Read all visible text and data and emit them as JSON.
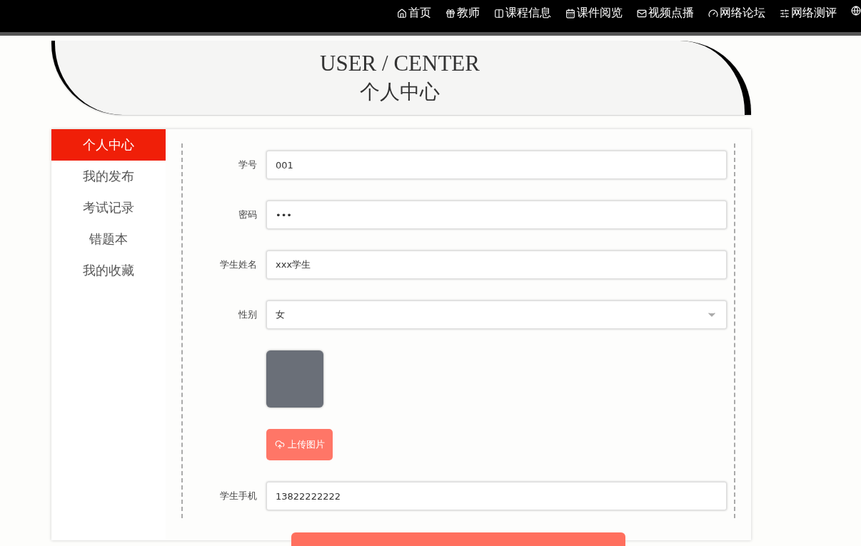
{
  "nav": {
    "items": [
      {
        "label": "首页"
      },
      {
        "label": "教师"
      },
      {
        "label": "课程信息"
      },
      {
        "label": "课件阅览"
      },
      {
        "label": "视频点播"
      },
      {
        "label": "网络论坛"
      },
      {
        "label": "网络测评"
      }
    ]
  },
  "header": {
    "title": "USER / CENTER",
    "subtitle": "个人中心"
  },
  "sidebar": {
    "items": [
      {
        "label": "个人中心",
        "selected": true
      },
      {
        "label": "我的发布",
        "selected": false
      },
      {
        "label": "考试记录",
        "selected": false
      },
      {
        "label": "错题本",
        "selected": false
      },
      {
        "label": "我的收藏",
        "selected": false
      }
    ]
  },
  "form": {
    "fields": [
      {
        "kind": "text",
        "label": "学号",
        "value": "001"
      },
      {
        "kind": "text",
        "label": "密码",
        "value": "•••"
      },
      {
        "kind": "text",
        "label": "学生姓名",
        "value": "xxx学生"
      },
      {
        "kind": "select",
        "label": "性别",
        "value": "女"
      },
      {
        "kind": "image",
        "upload_label": "上传图片"
      },
      {
        "kind": "text",
        "label": "学生手机",
        "value": "13822222222"
      }
    ]
  }
}
